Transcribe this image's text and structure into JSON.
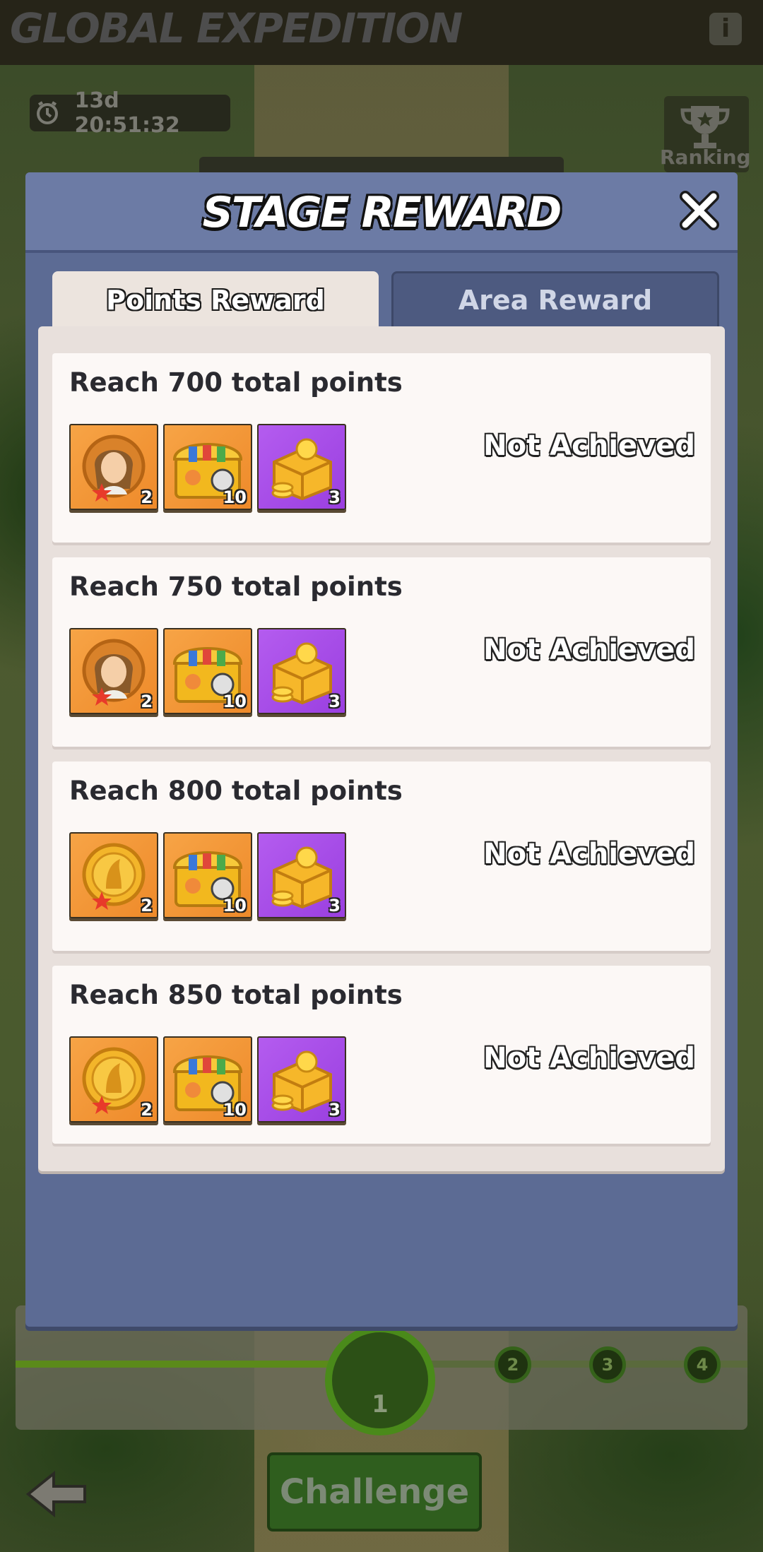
{
  "app": {
    "title": "GLOBAL EXPEDITION",
    "info_icon": "info-icon",
    "timer": "13d 20:51:32",
    "ranking_label": "Ranking"
  },
  "track": {
    "current_stage": "1",
    "stages": [
      "2",
      "3",
      "4"
    ]
  },
  "challenge_label": "Challenge",
  "modal": {
    "title": "STAGE REWARD",
    "tabs": [
      {
        "label": "Points Reward",
        "active": true
      },
      {
        "label": "Area Reward",
        "active": false
      }
    ],
    "rewards": [
      {
        "title": "Reach 700 total points",
        "status": "Not Achieved",
        "items": [
          {
            "icon": "hero-portrait-icon",
            "count": "2"
          },
          {
            "icon": "treasure-chest-icon",
            "count": "10"
          },
          {
            "icon": "gold-coin-crate-icon",
            "count": "3"
          }
        ]
      },
      {
        "title": "Reach 750 total points",
        "status": "Not Achieved",
        "items": [
          {
            "icon": "hero-portrait-icon",
            "count": "2"
          },
          {
            "icon": "treasure-chest-icon",
            "count": "10"
          },
          {
            "icon": "gold-coin-crate-icon",
            "count": "3"
          }
        ]
      },
      {
        "title": "Reach 800 total points",
        "status": "Not Achieved",
        "items": [
          {
            "icon": "gold-medal-icon",
            "count": "2"
          },
          {
            "icon": "treasure-chest-icon",
            "count": "10"
          },
          {
            "icon": "gold-coin-crate-icon",
            "count": "3"
          }
        ]
      },
      {
        "title": "Reach 850 total points",
        "status": "Not Achieved",
        "items": [
          {
            "icon": "gold-medal-icon",
            "count": "2"
          },
          {
            "icon": "treasure-chest-icon",
            "count": "10"
          },
          {
            "icon": "gold-coin-crate-icon",
            "count": "3"
          }
        ]
      }
    ]
  },
  "colors": {
    "modal_bg": "#5c6b94",
    "item_orange": "#f29a3a",
    "item_purple": "#a84cea"
  }
}
